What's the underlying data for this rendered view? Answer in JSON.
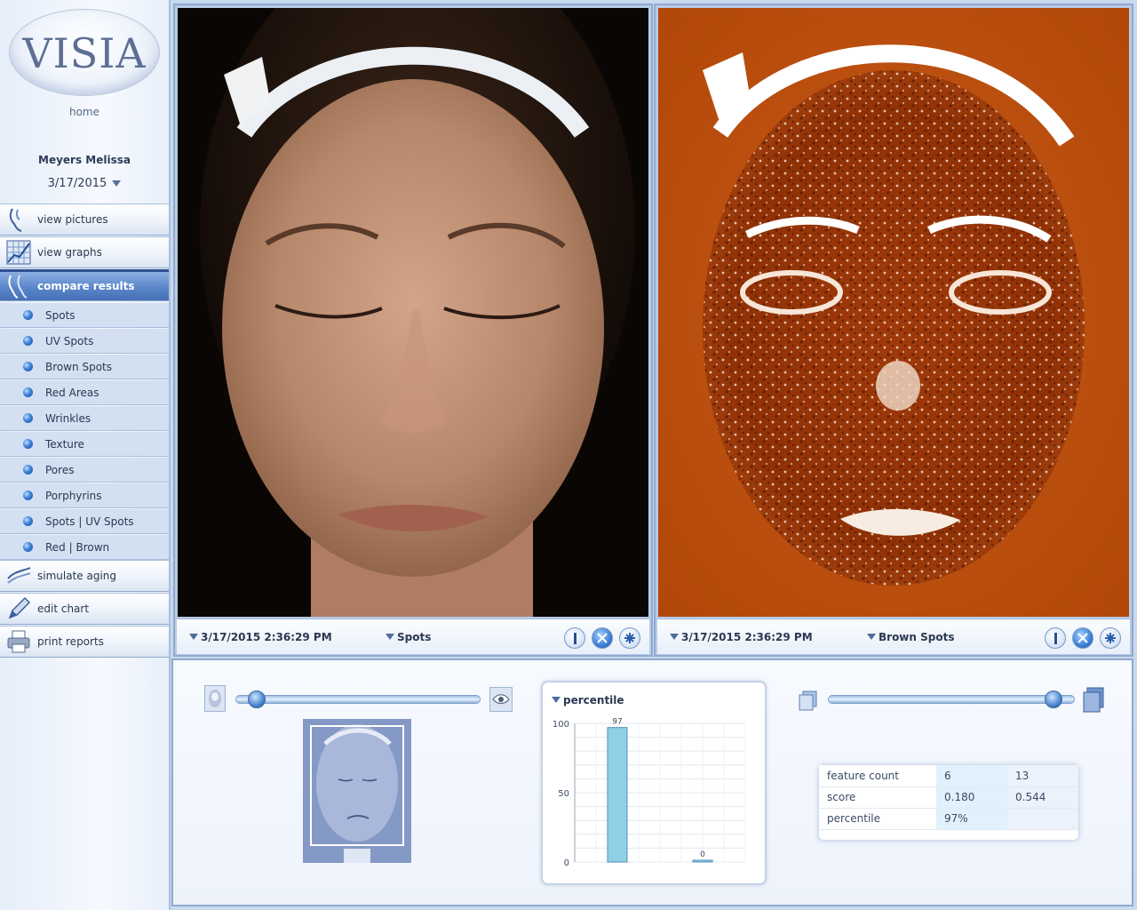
{
  "app": {
    "logo_text": "VISIA",
    "home_label": "home"
  },
  "patient": {
    "name": "Meyers Melissa",
    "date": "3/17/2015"
  },
  "nav": {
    "view_pictures": "view pictures",
    "view_graphs": "view graphs",
    "compare_results": "compare results",
    "simulate_aging": "simulate aging",
    "edit_chart": "edit chart",
    "print_reports": "print reports"
  },
  "compare_items": [
    "Spots",
    "UV Spots",
    "Brown Spots",
    "Red Areas",
    "Wrinkles",
    "Texture",
    "Pores",
    "Porphyrins",
    "Spots | UV Spots",
    "Red | Brown"
  ],
  "panels": {
    "left": {
      "timestamp": "3/17/2015 2:36:29 PM",
      "mode": "Spots"
    },
    "right": {
      "timestamp": "3/17/2015 2:36:29 PM",
      "mode": "Brown Spots"
    }
  },
  "percentile_chart": {
    "title": "percentile"
  },
  "chart_data": {
    "type": "bar",
    "categories": [
      "",
      ""
    ],
    "values": [
      97,
      0
    ],
    "ylim": [
      0,
      100
    ],
    "yticks": [
      0,
      50,
      100
    ],
    "grid": true,
    "title": "percentile"
  },
  "stats": {
    "rows": [
      {
        "label": "feature count",
        "v1": "6",
        "v2": "13"
      },
      {
        "label": "score",
        "v1": "0.180",
        "v2": "0.544"
      },
      {
        "label": "percentile",
        "v1": "97%",
        "v2": ""
      }
    ]
  },
  "sliders": {
    "left_position": 0.05,
    "right_position": 0.95
  },
  "colors": {
    "accent": "#4670b6",
    "panel_border": "#90a9cf",
    "brown_map": "#c24c10"
  }
}
